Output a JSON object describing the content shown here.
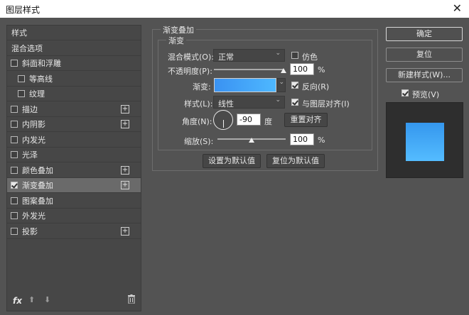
{
  "window": {
    "title": "图层样式",
    "close_glyph": "✕"
  },
  "styles": [
    {
      "label": "样式",
      "checkbox": false,
      "checked": false,
      "indent": false,
      "plus": false,
      "active": false
    },
    {
      "label": "混合选项",
      "checkbox": false,
      "checked": false,
      "indent": false,
      "plus": false,
      "active": false
    },
    {
      "label": "斜面和浮雕",
      "checkbox": true,
      "checked": false,
      "indent": false,
      "plus": false,
      "active": false
    },
    {
      "label": "等高线",
      "checkbox": true,
      "checked": false,
      "indent": true,
      "plus": false,
      "active": false
    },
    {
      "label": "纹理",
      "checkbox": true,
      "checked": false,
      "indent": true,
      "plus": false,
      "active": false
    },
    {
      "label": "描边",
      "checkbox": true,
      "checked": false,
      "indent": false,
      "plus": true,
      "active": false
    },
    {
      "label": "内阴影",
      "checkbox": true,
      "checked": false,
      "indent": false,
      "plus": true,
      "active": false
    },
    {
      "label": "内发光",
      "checkbox": true,
      "checked": false,
      "indent": false,
      "plus": false,
      "active": false
    },
    {
      "label": "光泽",
      "checkbox": true,
      "checked": false,
      "indent": false,
      "plus": false,
      "active": false
    },
    {
      "label": "颜色叠加",
      "checkbox": true,
      "checked": false,
      "indent": false,
      "plus": true,
      "active": false
    },
    {
      "label": "渐变叠加",
      "checkbox": true,
      "checked": true,
      "indent": false,
      "plus": true,
      "active": true
    },
    {
      "label": "图案叠加",
      "checkbox": true,
      "checked": false,
      "indent": false,
      "plus": false,
      "active": false
    },
    {
      "label": "外发光",
      "checkbox": true,
      "checked": false,
      "indent": false,
      "plus": false,
      "active": false
    },
    {
      "label": "投影",
      "checkbox": true,
      "checked": false,
      "indent": false,
      "plus": true,
      "active": false
    }
  ],
  "footer": {
    "fx_label": "fx",
    "up_arrow": "⬆",
    "down_arrow": "⬇"
  },
  "gradient_overlay": {
    "group_title": "渐变叠加",
    "subgroup_title": "渐变",
    "blend_mode_label": "混合模式(O):",
    "blend_mode_value": "正常",
    "dither_label": "仿色",
    "dither_checked": false,
    "opacity_label": "不透明度(P):",
    "opacity_value": "100",
    "opacity_unit": "%",
    "opacity_level": 1.0,
    "gradient_label": "渐变:",
    "gradient_colors": [
      "#3a92f2",
      "#4eb8ff"
    ],
    "reverse_label": "反向(R)",
    "reverse_checked": true,
    "style_label": "样式(L):",
    "style_value": "线性",
    "align_label": "与图层对齐(I)",
    "align_checked": true,
    "angle_label": "角度(N):",
    "angle_value": "-90",
    "angle_unit": "度",
    "reset_align_label": "重置对齐",
    "scale_label": "缩放(S):",
    "scale_value": "100",
    "scale_unit": "%",
    "scale_level": 0.5,
    "set_default_label": "设置为默认值",
    "reset_default_label": "复位为默认值"
  },
  "actions": {
    "ok_label": "确定",
    "reset_label": "复位",
    "new_style_label": "新建样式(W)...",
    "preview_label": "预览(V)",
    "preview_checked": true
  },
  "colors": {
    "accent": "#3a92f2",
    "preview_top": "#3597ee",
    "preview_bottom": "#54bcff"
  }
}
